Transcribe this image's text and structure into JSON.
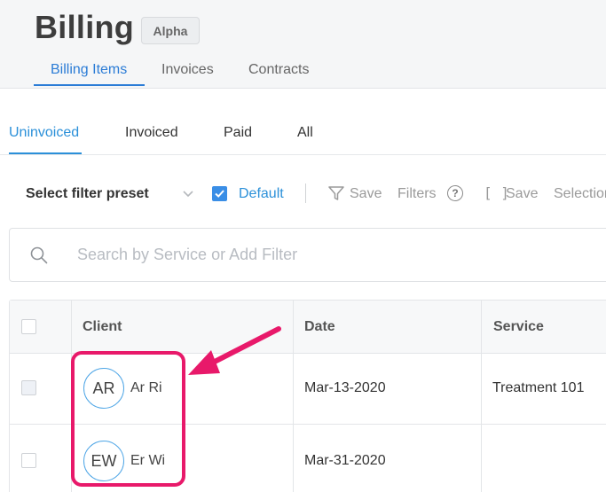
{
  "header": {
    "title": "Billing",
    "badge": "Alpha",
    "tabs": [
      {
        "label": "Billing Items",
        "active": true
      },
      {
        "label": "Invoices",
        "active": false
      },
      {
        "label": "Contracts",
        "active": false
      }
    ]
  },
  "subtabs": [
    {
      "label": "Uninvoiced",
      "active": true
    },
    {
      "label": "Invoiced",
      "active": false
    },
    {
      "label": "Paid",
      "active": false
    },
    {
      "label": "All",
      "active": false
    }
  ],
  "filterbar": {
    "preset_label": "Select filter preset",
    "default_label": "Default",
    "default_checked": true,
    "save_filters": "Save",
    "filters_label": "Filters",
    "brackets": "[ ]",
    "save_selection": "Save",
    "selection_label": "Selection",
    "help_glyph": "?"
  },
  "search": {
    "placeholder": "Search by Service or Add Filter",
    "icon": "search-icon"
  },
  "table": {
    "columns": [
      "Client",
      "Date",
      "Service"
    ],
    "rows": [
      {
        "initials": "AR",
        "client": "Ar Ri",
        "date": "Mar-13-2020",
        "service": "Treatment 101"
      },
      {
        "initials": "EW",
        "client": "Er Wi",
        "date": "Mar-31-2020",
        "service": ""
      }
    ]
  },
  "colors": {
    "accent": "#2b90d9",
    "annotation": "#e8196a",
    "avatar_border": "#4fa6e6"
  }
}
